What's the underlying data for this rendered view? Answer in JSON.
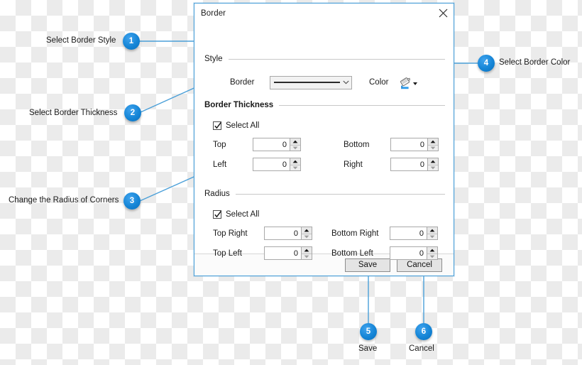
{
  "background": {
    "pattern": "transparency-checkerboard",
    "colors": [
      "#ffffff",
      "#ebebeb"
    ]
  },
  "accent_color": "#1585d6",
  "dialog": {
    "title": "Border",
    "close_icon": "close-icon",
    "groups": {
      "style": {
        "title": "Style",
        "border_label": "Border",
        "border_value": "solid-line-sample",
        "dropdown_icon": "chevron-down-icon",
        "color_label": "Color",
        "color_icon": "paint-bucket-icon",
        "color_dropdown_icon": "triangle-down-icon"
      },
      "thickness": {
        "title": "Border Thickness",
        "select_all_label": "Select All",
        "select_all_checked": true,
        "fields": [
          {
            "label": "Top",
            "value": "0"
          },
          {
            "label": "Bottom",
            "value": "0"
          },
          {
            "label": "Left",
            "value": "0"
          },
          {
            "label": "Right",
            "value": "0"
          }
        ]
      },
      "radius": {
        "title": "Radius",
        "select_all_label": "Select All",
        "select_all_checked": true,
        "fields": [
          {
            "label": "Top Right",
            "value": "0"
          },
          {
            "label": "Bottom Right",
            "value": "0"
          },
          {
            "label": "Top Left",
            "value": "0"
          },
          {
            "label": "Bottom Left",
            "value": "0"
          }
        ]
      }
    },
    "footer": {
      "save_label": "Save",
      "cancel_label": "Cancel"
    }
  },
  "annotations": [
    {
      "number": "1",
      "label": "Select Border Style"
    },
    {
      "number": "2",
      "label": "Select Border Thickness"
    },
    {
      "number": "3",
      "label": "Change the Radius of Corners"
    },
    {
      "number": "4",
      "label": "Select Border Color"
    },
    {
      "number": "5",
      "label": "Save"
    },
    {
      "number": "6",
      "label": "Cancel"
    }
  ]
}
